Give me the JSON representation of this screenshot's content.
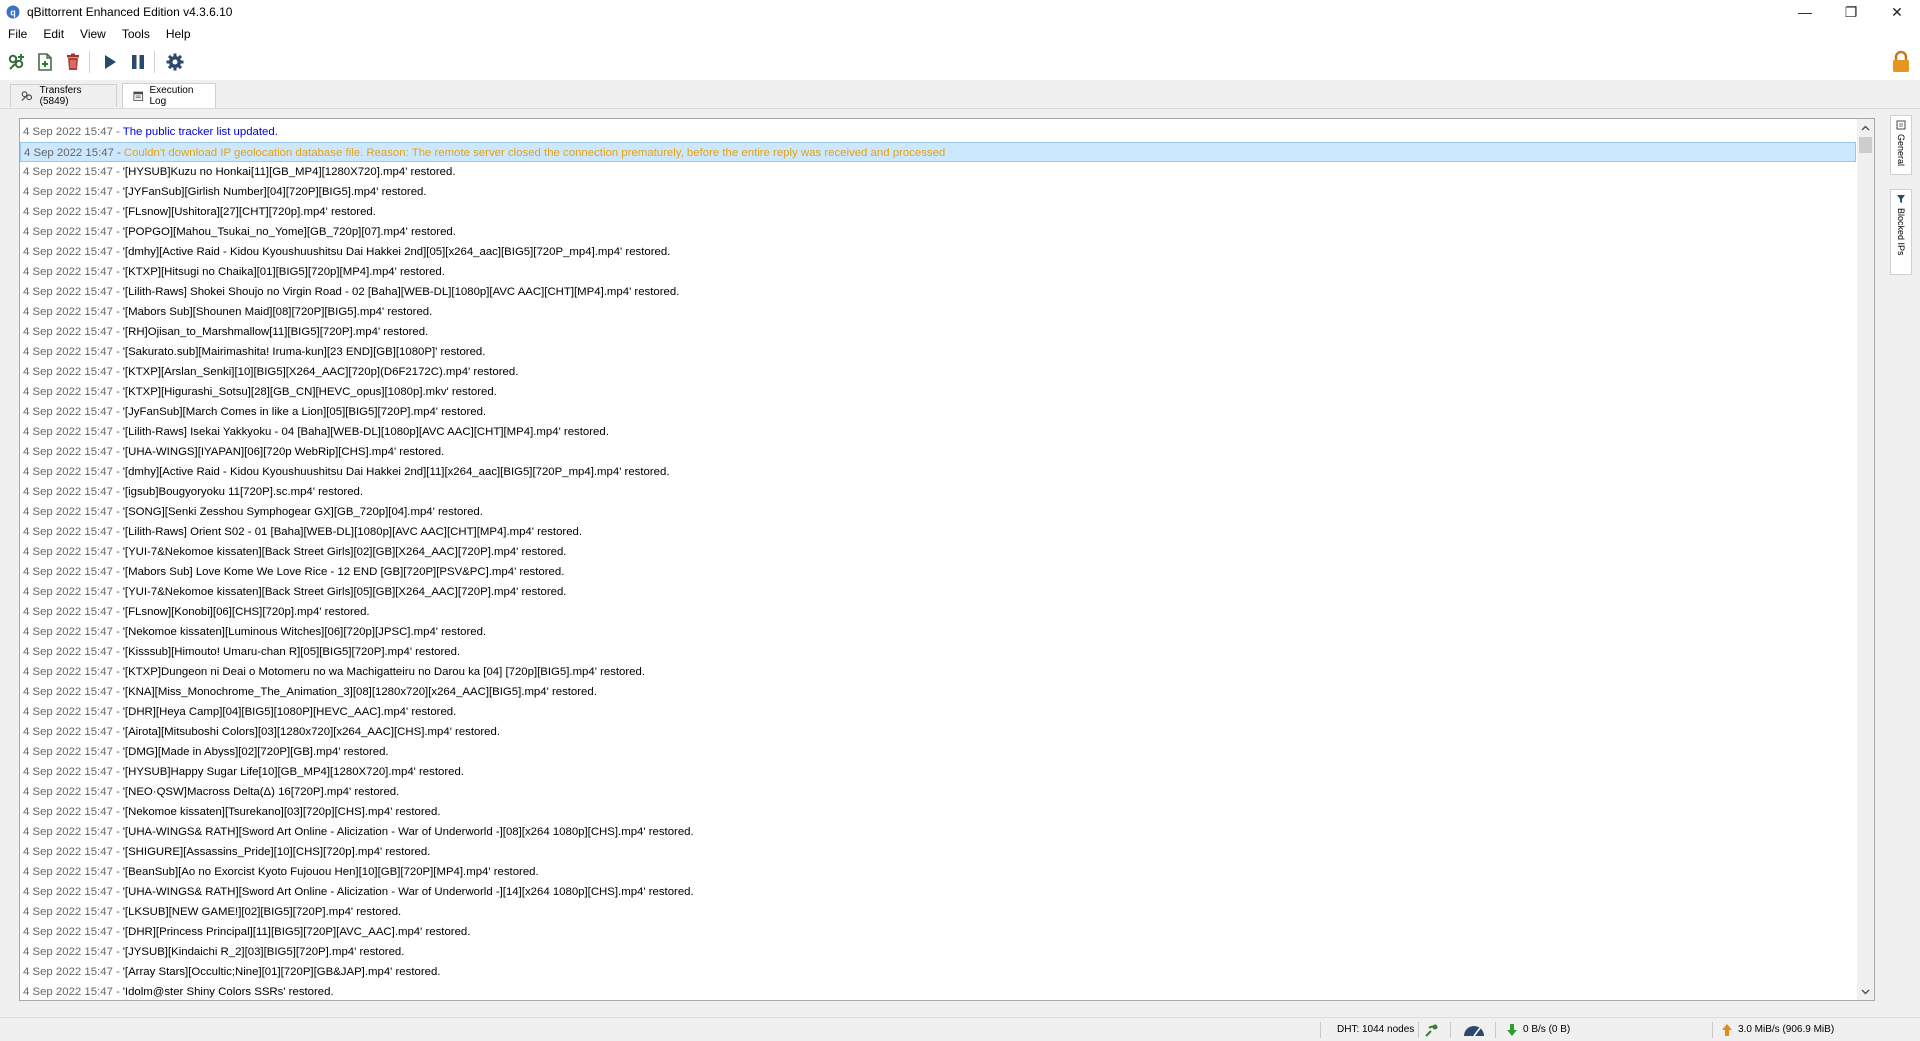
{
  "window": {
    "title": "qBittorrent Enhanced Edition v4.3.6.10",
    "controls": {
      "minimize": "—",
      "maximize": "❐",
      "close": "✕"
    }
  },
  "menu": {
    "items": [
      "File",
      "Edit",
      "View",
      "Tools",
      "Help"
    ]
  },
  "toolbar": {
    "buttons": [
      "add-torrent-link-icon",
      "add-torrent-file-icon",
      "delete-icon",
      "resume-icon",
      "pause-icon",
      "options-gear-icon"
    ],
    "lock_icon": "lock-icon"
  },
  "tabs": [
    {
      "label": "Transfers (5849)",
      "icon": "transfers-icon"
    },
    {
      "label": "Execution Log",
      "icon": "log-icon"
    }
  ],
  "dock": {
    "tabs": [
      "General",
      "Blocked IPs"
    ]
  },
  "log": {
    "separator": "-",
    "rows": [
      {
        "time": "4 Sep 2022 15:47",
        "message": "The public tracker list updated.",
        "type": "info"
      },
      {
        "time": "4 Sep 2022 15:47",
        "message": "Couldn't download IP geolocation database file. Reason: The remote server closed the connection prematurely, before the entire reply was received and processed",
        "type": "warning"
      },
      {
        "time": "4 Sep 2022 15:47",
        "message": "'[HYSUB]Kuzu no Honkai[11][GB_MP4][1280X720].mp4' restored.",
        "type": "normal"
      },
      {
        "time": "4 Sep 2022 15:47",
        "message": "'[JYFanSub][Girlish Number][04][720P][BIG5].mp4' restored.",
        "type": "normal"
      },
      {
        "time": "4 Sep 2022 15:47",
        "message": "'[FLsnow][Ushitora][27][CHT][720p].mp4' restored.",
        "type": "normal"
      },
      {
        "time": "4 Sep 2022 15:47",
        "message": "'[POPGO][Mahou_Tsukai_no_Yome][GB_720p][07].mp4' restored.",
        "type": "normal"
      },
      {
        "time": "4 Sep 2022 15:47",
        "message": "'[dmhy][Active Raid - Kidou Kyoushuushitsu Dai Hakkei 2nd][05][x264_aac][BIG5][720P_mp4].mp4' restored.",
        "type": "normal"
      },
      {
        "time": "4 Sep 2022 15:47",
        "message": "'[KTXP][Hitsugi no Chaika][01][BIG5][720p][MP4].mp4' restored.",
        "type": "normal"
      },
      {
        "time": "4 Sep 2022 15:47",
        "message": "'[Lilith-Raws] Shokei Shoujo no Virgin Road - 02 [Baha][WEB-DL][1080p][AVC AAC][CHT][MP4].mp4' restored.",
        "type": "normal"
      },
      {
        "time": "4 Sep 2022 15:47",
        "message": "'[Mabors Sub][Shounen Maid][08][720P][BIG5].mp4' restored.",
        "type": "normal"
      },
      {
        "time": "4 Sep 2022 15:47",
        "message": "'[RH]Ojisan_to_Marshmallow[11][BIG5][720P].mp4' restored.",
        "type": "normal"
      },
      {
        "time": "4 Sep 2022 15:47",
        "message": "'[Sakurato.sub][Mairimashita! Iruma-kun][23 END][GB][1080P]' restored.",
        "type": "normal"
      },
      {
        "time": "4 Sep 2022 15:47",
        "message": "'[KTXP][Arslan_Senki][10][BIG5][X264_AAC][720p](D6F2172C).mp4' restored.",
        "type": "normal"
      },
      {
        "time": "4 Sep 2022 15:47",
        "message": "'[KTXP][Higurashi_Sotsu][28][GB_CN][HEVC_opus][1080p].mkv' restored.",
        "type": "normal"
      },
      {
        "time": "4 Sep 2022 15:47",
        "message": "'[JyFanSub][March Comes in like a Lion][05][BIG5][720P].mp4' restored.",
        "type": "normal"
      },
      {
        "time": "4 Sep 2022 15:47",
        "message": "'[Lilith-Raws] Isekai Yakkyoku - 04 [Baha][WEB-DL][1080p][AVC AAC][CHT][MP4].mp4' restored.",
        "type": "normal"
      },
      {
        "time": "4 Sep 2022 15:47",
        "message": "'[UHA-WINGS][IYAPAN][06][720p WebRip][CHS].mp4' restored.",
        "type": "normal"
      },
      {
        "time": "4 Sep 2022 15:47",
        "message": "'[dmhy][Active Raid - Kidou Kyoushuushitsu Dai Hakkei 2nd][11][x264_aac][BIG5][720P_mp4].mp4' restored.",
        "type": "normal"
      },
      {
        "time": "4 Sep 2022 15:47",
        "message": "'[igsub]Bougyoryoku 11[720P].sc.mp4' restored.",
        "type": "normal"
      },
      {
        "time": "4 Sep 2022 15:47",
        "message": "'[SONG][Senki Zesshou Symphogear GX][GB_720p][04].mp4' restored.",
        "type": "normal"
      },
      {
        "time": "4 Sep 2022 15:47",
        "message": "'[Lilith-Raws] Orient S02 - 01 [Baha][WEB-DL][1080p][AVC AAC][CHT][MP4].mp4' restored.",
        "type": "normal"
      },
      {
        "time": "4 Sep 2022 15:47",
        "message": "'[YUI-7&Nekomoe kissaten][Back Street Girls][02][GB][X264_AAC][720P].mp4' restored.",
        "type": "normal"
      },
      {
        "time": "4 Sep 2022 15:47",
        "message": "'[Mabors Sub] Love Kome We Love Rice - 12 END [GB][720P][PSV&PC].mp4' restored.",
        "type": "normal"
      },
      {
        "time": "4 Sep 2022 15:47",
        "message": "'[YUI-7&Nekomoe kissaten][Back Street Girls][05][GB][X264_AAC][720P].mp4' restored.",
        "type": "normal"
      },
      {
        "time": "4 Sep 2022 15:47",
        "message": "'[FLsnow][Konobi][06][CHS][720p].mp4' restored.",
        "type": "normal"
      },
      {
        "time": "4 Sep 2022 15:47",
        "message": "'[Nekomoe kissaten][Luminous Witches][06][720p][JPSC].mp4' restored.",
        "type": "normal"
      },
      {
        "time": "4 Sep 2022 15:47",
        "message": "'[Kisssub][Himouto! Umaru-chan R][05][BIG5][720P].mp4' restored.",
        "type": "normal"
      },
      {
        "time": "4 Sep 2022 15:47",
        "message": "'[KTXP]Dungeon ni Deai o Motomeru no wa Machigatteiru no Darou ka [04] [720p][BIG5].mp4' restored.",
        "type": "normal"
      },
      {
        "time": "4 Sep 2022 15:47",
        "message": "'[KNA][Miss_Monochrome_The_Animation_3][08][1280x720][x264_AAC][BIG5].mp4' restored.",
        "type": "normal"
      },
      {
        "time": "4 Sep 2022 15:47",
        "message": "'[DHR][Heya Camp][04][BIG5][1080P][HEVC_AAC].mp4' restored.",
        "type": "normal"
      },
      {
        "time": "4 Sep 2022 15:47",
        "message": "'[Airota][Mitsuboshi Colors][03][1280x720][x264_AAC][CHS].mp4' restored.",
        "type": "normal"
      },
      {
        "time": "4 Sep 2022 15:47",
        "message": "'[DMG][Made in Abyss][02][720P][GB].mp4' restored.",
        "type": "normal"
      },
      {
        "time": "4 Sep 2022 15:47",
        "message": "'[HYSUB]Happy Sugar Life[10][GB_MP4][1280X720].mp4' restored.",
        "type": "normal"
      },
      {
        "time": "4 Sep 2022 15:47",
        "message": "'[NEO·QSW]Macross Delta(Δ) 16[720P].mp4' restored.",
        "type": "normal"
      },
      {
        "time": "4 Sep 2022 15:47",
        "message": "'[Nekomoe kissaten][Tsurekano][03][720p][CHS].mp4' restored.",
        "type": "normal"
      },
      {
        "time": "4 Sep 2022 15:47",
        "message": "'[UHA-WINGS& RATH][Sword Art Online - Alicization - War of Underworld -][08][x264 1080p][CHS].mp4' restored.",
        "type": "normal"
      },
      {
        "time": "4 Sep 2022 15:47",
        "message": "'[SHIGURE][Assassins_Pride][10][CHS][720p].mp4' restored.",
        "type": "normal"
      },
      {
        "time": "4 Sep 2022 15:47",
        "message": "'[BeanSub][Ao no Exorcist Kyoto Fujouou Hen][10][GB][720P][MP4].mp4' restored.",
        "type": "normal"
      },
      {
        "time": "4 Sep 2022 15:47",
        "message": "'[UHA-WINGS& RATH][Sword Art Online - Alicization - War of Underworld -][14][x264 1080p][CHS].mp4' restored.",
        "type": "normal"
      },
      {
        "time": "4 Sep 2022 15:47",
        "message": "'[LKSUB][NEW GAME!][02][BIG5][720P].mp4' restored.",
        "type": "normal"
      },
      {
        "time": "4 Sep 2022 15:47",
        "message": "'[DHR][Princess Principal][11][BIG5][720P][AVC_AAC].mp4' restored.",
        "type": "normal"
      },
      {
        "time": "4 Sep 2022 15:47",
        "message": "'[JYSUB][Kindaichi R_2][03][BIG5][720P].mp4' restored.",
        "type": "normal"
      },
      {
        "time": "4 Sep 2022 15:47",
        "message": "'[Array Stars][Occultic;Nine][01][720P][GB&JAP].mp4' restored.",
        "type": "normal"
      },
      {
        "time": "4 Sep 2022 15:47",
        "message": "'Idolm@ster Shiny Colors SSRs' restored.",
        "type": "normal"
      }
    ],
    "selected_index": 1
  },
  "statusbar": {
    "dht": "DHT: 1044 nodes",
    "download": "0 B/s (0 B)",
    "upload": "3.0 MiB/s (906.9 MiB)",
    "colors": {
      "download_arrow": "#2e9c2e",
      "upload_arrow": "#e08b1a"
    }
  }
}
